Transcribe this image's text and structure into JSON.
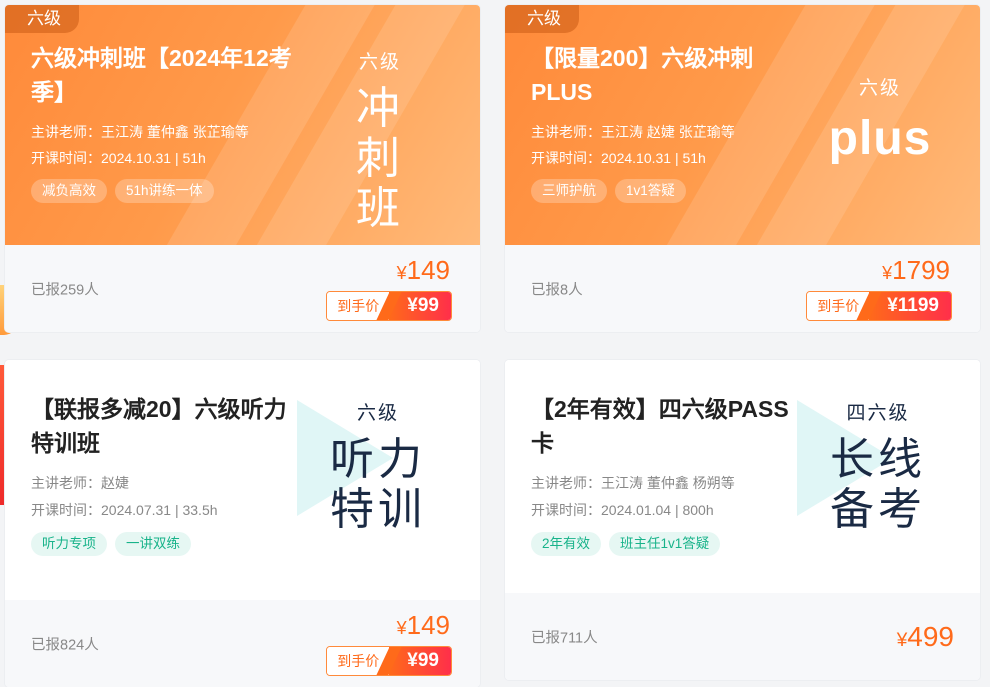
{
  "cards": [
    {
      "level_tag": "六级",
      "title": "六级冲刺班【2024年12考季】",
      "teachers": "主讲老师：王江涛 董仲鑫 张芷瑜等",
      "start": "开课时间：2024.10.31 | 51h",
      "tags": [
        "减负高效",
        "51h讲练一体"
      ],
      "deco_small": "六级",
      "deco_big_1": "冲刺",
      "deco_big_2": "班",
      "enrolled": "已报259人",
      "price": "149",
      "final_label": "到手价",
      "final_price": "¥99"
    },
    {
      "level_tag": "六级",
      "title": "【限量200】六级冲刺PLUS",
      "teachers": "主讲老师：王江涛 赵婕 张芷瑜等",
      "start": "开课时间：2024.10.31 | 51h",
      "tags": [
        "三师护航",
        "1v1答疑"
      ],
      "deco_small": "六级",
      "deco_big_1": "plus",
      "enrolled": "已报8人",
      "price": "1799",
      "final_label": "到手价",
      "final_price": "¥1199"
    },
    {
      "title": "【联报多减20】六级听力特训班",
      "teachers": "主讲老师：赵婕",
      "start": "开课时间：2024.07.31 | 33.5h",
      "tags": [
        "听力专项",
        "一讲双练"
      ],
      "deco_small": "六级",
      "deco_big_1": "听力",
      "deco_big_2": "特训",
      "enrolled": "已报824人",
      "price": "149",
      "final_label": "到手价",
      "final_price": "¥99"
    },
    {
      "title": "【2年有效】四六级PASS卡",
      "teachers": "主讲老师：王江涛 董仲鑫 杨朔等",
      "start": "开课时间：2024.01.04 | 800h",
      "tags": [
        "2年有效",
        "班主任1v1答疑"
      ],
      "deco_small": "四六级",
      "deco_big_1": "长线",
      "deco_big_2": "备考",
      "enrolled": "已报711人",
      "price": "499"
    }
  ],
  "currency": "¥"
}
